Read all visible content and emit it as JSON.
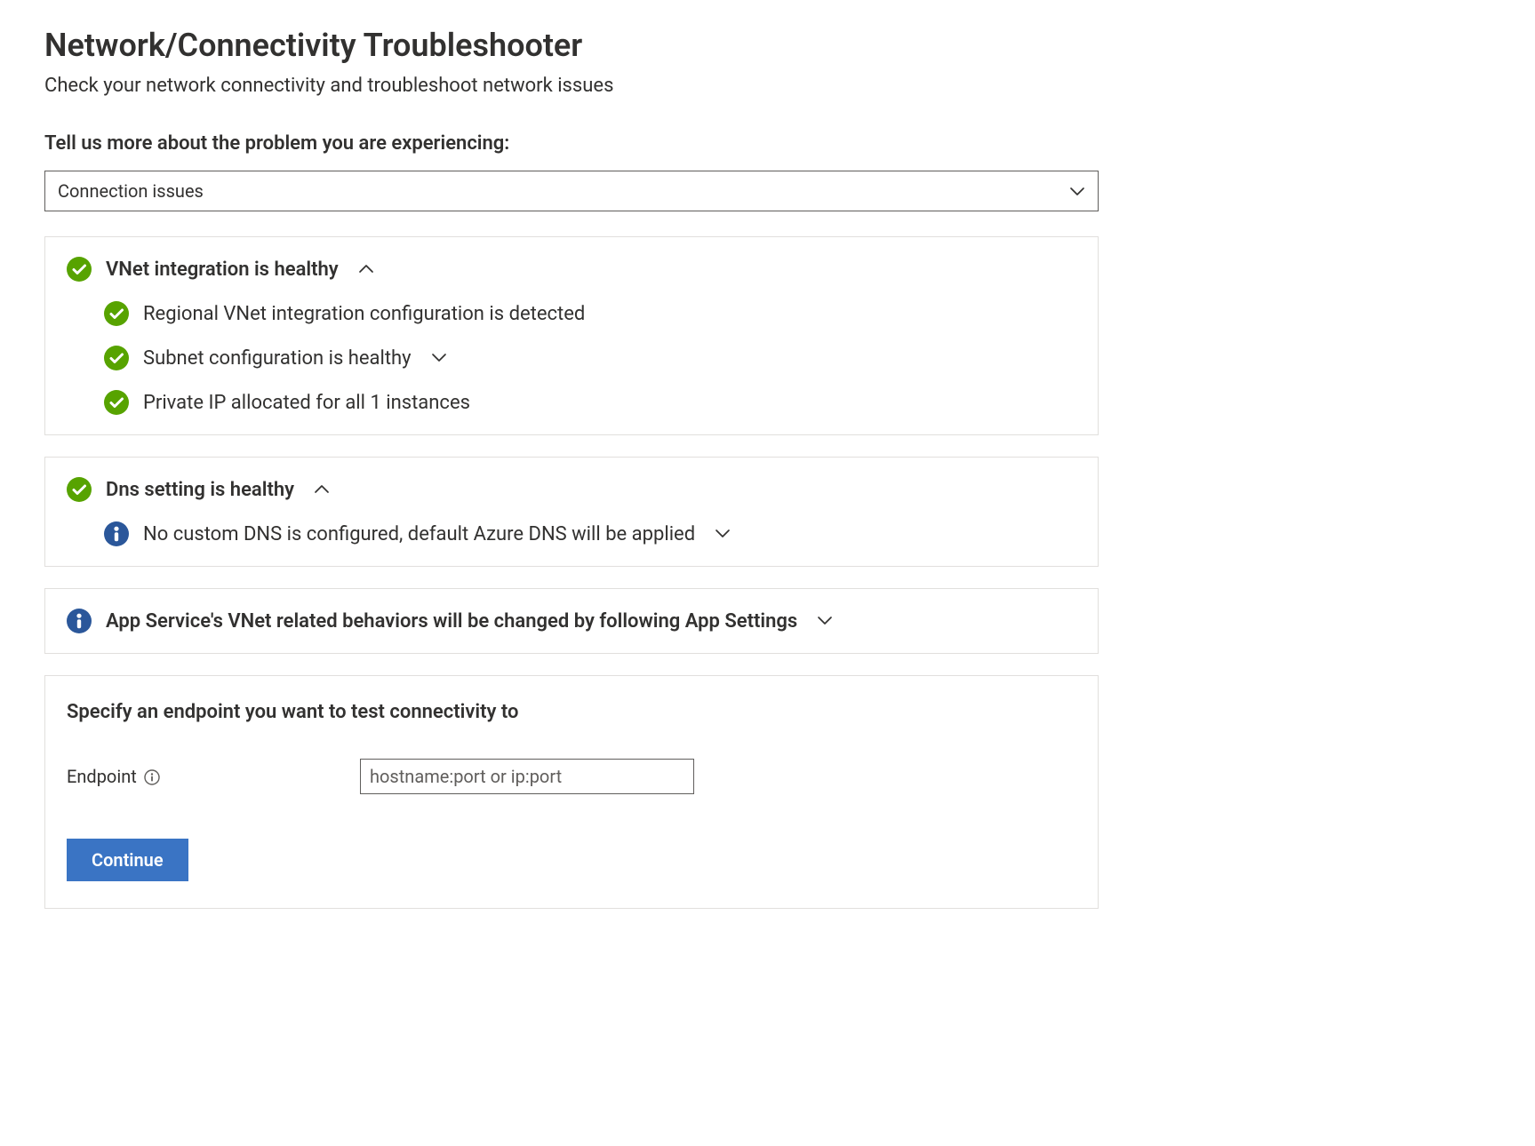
{
  "header": {
    "title": "Network/Connectivity Troubleshooter",
    "subtitle": "Check your network connectivity and troubleshoot network issues"
  },
  "prompt": {
    "label": "Tell us more about the problem you are experiencing:",
    "selected": "Connection issues"
  },
  "panels": {
    "vnet": {
      "title": "VNet integration is healthy",
      "items": [
        "Regional VNet integration configuration is detected",
        "Subnet configuration is healthy",
        "Private IP allocated for all 1 instances"
      ]
    },
    "dns": {
      "title": "Dns setting is healthy",
      "items": [
        "No custom DNS is configured, default Azure DNS will be applied"
      ]
    },
    "appsettings": {
      "title": "App Service's VNet related behaviors will be changed by following App Settings"
    }
  },
  "endpoint": {
    "title": "Specify an endpoint you want to test connectivity to",
    "field_label": "Endpoint",
    "placeholder": "hostname:port or ip:port",
    "value": ""
  },
  "actions": {
    "continue": "Continue"
  },
  "colors": {
    "success": "#57a300",
    "info": "#2b579a",
    "primary": "#3a74c4"
  }
}
